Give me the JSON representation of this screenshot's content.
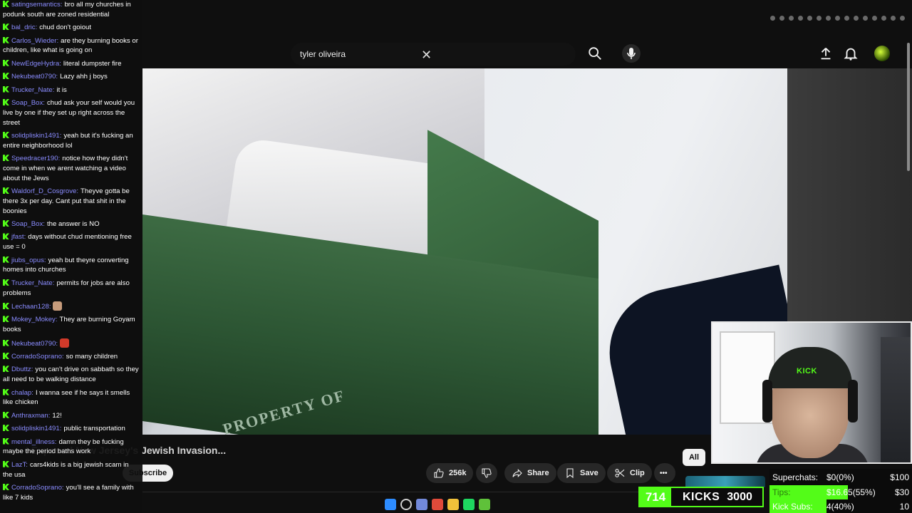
{
  "search": {
    "query": "tyler oliveira"
  },
  "video": {
    "title": "I Exposed New Jersey's Jewish Invasion...",
    "printed_text": "PROPERTY OF"
  },
  "channel": {
    "subscribe_label": "Subscribe"
  },
  "actions": {
    "like_count": "256k",
    "share_label": "Share",
    "save_label": "Save",
    "clip_label": "Clip",
    "more_label": "•••"
  },
  "chip": {
    "label": "All"
  },
  "chat": {
    "messages": [
      {
        "user": "satingsemantics",
        "text": "bro all my churches in podunk south are zoned residential"
      },
      {
        "user": "bal_dric",
        "text": "chud don't goiout"
      },
      {
        "user": "Carlos_Wieder",
        "text": "are they burning books or children, like what is going on"
      },
      {
        "user": "NewEdgeHydra",
        "text": "literal dumpster fire"
      },
      {
        "user": "Nekubeat0790",
        "text": "Lazy ahh j boys"
      },
      {
        "user": "Trucker_Nate",
        "text": "it is"
      },
      {
        "user": "Soap_Box",
        "text": "chud ask your self would you live by one if they set up right across the street"
      },
      {
        "user": "solidpliskin1491",
        "text": "yeah but it's fucking an entire neighborhood lol"
      },
      {
        "user": "Speedracer190",
        "text": "notice how they didn't come in when we arent watching a video about the Jews"
      },
      {
        "user": "Waldorf_D_Cosgrove",
        "text": "Theyve gotta be there 3x per day. Cant put that shit in the boonies"
      },
      {
        "user": "Soap_Box",
        "text": "the answer is NO"
      },
      {
        "user": "jfast",
        "text": "days without chud mentioning free use = 0"
      },
      {
        "user": "jiubs_opus",
        "text": "yeah but theyre converting homes into churches"
      },
      {
        "user": "Trucker_Nate",
        "text": "permits for jobs are also problems"
      },
      {
        "user": "Lechaan128",
        "text": "",
        "emote": "#c69b7b"
      },
      {
        "user": "Mokey_Mokey",
        "text": "They are burning Goyam books"
      },
      {
        "user": "Nekubeat0790",
        "text": "",
        "emote": "#d13a2a"
      },
      {
        "user": "CorradoSoprano",
        "text": "so many children"
      },
      {
        "user": "Dbuttz",
        "text": "you can't drive on sabbath so they all need to be walking distance"
      },
      {
        "user": "chalap",
        "text": "I wanna see if he says it smells like chicken"
      },
      {
        "user": "Anthraxman",
        "text": "12!"
      },
      {
        "user": "solidpliskin1491",
        "text": "public transportation"
      },
      {
        "user": "mental_illness",
        "text": "damn they be fucking maybe the period baths work"
      },
      {
        "user": "LazT",
        "text": "cars4kids is a big jewish scam in the usa"
      },
      {
        "user": "CorradoSoprano",
        "text": "you'll see a family with like 7 kids"
      }
    ]
  },
  "webcam": {
    "cap_logo": "KICK"
  },
  "kicks": {
    "count": "714",
    "label": "KICKS",
    "goal": "3000"
  },
  "goals": [
    {
      "label": "Superchats:",
      "value": "$0(0%)",
      "target": "$100",
      "fraction": 0.0
    },
    {
      "label": "Tips:",
      "value": "$16.65(55%)",
      "target": "$30",
      "fraction": 0.55
    },
    {
      "label": "Kick Subs:",
      "value": "4(40%)",
      "target": "10",
      "fraction": 0.4
    }
  ],
  "colors": {
    "kick_green": "#53fc18",
    "chat_user": "#8a8cff",
    "bg": "#0f0f0f"
  },
  "taskbar": {
    "icons": [
      "windows-start-icon",
      "search-icon",
      "discord-icon",
      "chrome-icon",
      "file-explorer-icon",
      "spotify-icon",
      "xbox-icon"
    ]
  }
}
